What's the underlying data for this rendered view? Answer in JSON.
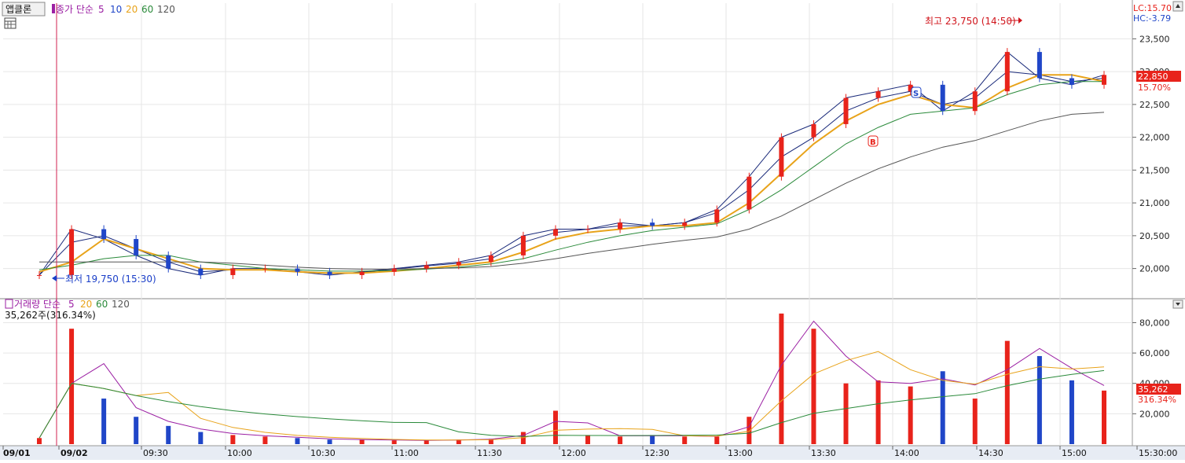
{
  "stock_name": "앱클론",
  "price_legend": {
    "prefix": "종가 단순",
    "periods": [
      "5",
      "10",
      "20",
      "60",
      "120"
    ]
  },
  "volume_legend": {
    "prefix": "거래량 단순",
    "periods": [
      "5",
      "20",
      "60",
      "120"
    ]
  },
  "volume_readout": "35,262주(316.34%)",
  "limit_info": {
    "lc": "LC:15.70",
    "hc": "HC:-3.79"
  },
  "current_price": {
    "value": "22,850",
    "change": "15.70%"
  },
  "current_volume": {
    "value": "35,262",
    "change": "316.34%"
  },
  "annotations": {
    "high": "최고 23,750 (14:50)",
    "low": "최저 19,750 (15:30)",
    "buy_marker": "B",
    "sell_marker": "S"
  },
  "colors": {
    "up": "#e8231b",
    "down": "#2046c8",
    "ma5": "#1a2a7a",
    "ma10": "#1a2a7a",
    "ma20": "#e8a31a",
    "ma60": "#2a8a3a",
    "ma120": "#555555",
    "legend_ma5": "#9b1fa3",
    "legend_ma10": "#2046c8",
    "legend_ma20": "#e8a31a",
    "legend_ma60": "#2a8a3a",
    "legend_ma120": "#555555",
    "grid": "#e6e6e6",
    "axis_bg": "#e7ecf4"
  },
  "chart_data": [
    {
      "type": "candlestick",
      "title": "",
      "x_ticks": [
        "09/01",
        "09/02",
        "09:30",
        "10:00",
        "10:30",
        "11:00",
        "11:30",
        "12:00",
        "12:30",
        "13:00",
        "13:30",
        "14:00",
        "14:30",
        "15:00",
        "15:30:00"
      ],
      "y_ticks": [
        20000,
        20500,
        21000,
        21500,
        22000,
        22500,
        23000,
        23500
      ],
      "ylim": [
        19600,
        23900
      ],
      "grid": true,
      "series": [
        {
          "name": "5",
          "values": [
            19900,
            20600,
            20450,
            20200,
            20000,
            19900,
            20000,
            20000,
            19950,
            19900,
            19950,
            20000,
            20050,
            20100,
            20200,
            20500,
            20600,
            20600,
            20700,
            20650,
            20700,
            20900,
            21400,
            22000,
            22200,
            22600,
            22700,
            22800,
            22400,
            22700,
            23300,
            22900,
            22800,
            22950
          ]
        },
        {
          "name": "10",
          "values": [
            19900,
            20400,
            20500,
            20300,
            20100,
            19950,
            19980,
            19980,
            19960,
            19920,
            19940,
            19990,
            20040,
            20080,
            20150,
            20400,
            20550,
            20600,
            20650,
            20650,
            20700,
            20850,
            21200,
            21700,
            22000,
            22400,
            22600,
            22700,
            22500,
            22600,
            23000,
            22950,
            22850,
            22900
          ]
        },
        {
          "name": "20",
          "values": [
            19950,
            20100,
            20450,
            20300,
            20150,
            20000,
            19980,
            19980,
            19950,
            19930,
            19930,
            19960,
            20000,
            20050,
            20100,
            20250,
            20450,
            20550,
            20600,
            20650,
            20650,
            20700,
            21000,
            21450,
            21900,
            22250,
            22500,
            22650,
            22500,
            22450,
            22750,
            22950,
            22950,
            22850
          ]
        },
        {
          "name": "60",
          "values": [
            19980,
            20050,
            20150,
            20200,
            20200,
            20100,
            20050,
            20000,
            19980,
            19960,
            19960,
            19970,
            19990,
            20020,
            20070,
            20150,
            20280,
            20400,
            20500,
            20580,
            20630,
            20680,
            20900,
            21200,
            21550,
            21900,
            22150,
            22350,
            22400,
            22450,
            22650,
            22800,
            22850,
            22850
          ]
        },
        {
          "name": "120",
          "values": [
            20100,
            20100,
            20100,
            20100,
            20100,
            20100,
            20080,
            20050,
            20020,
            20000,
            19990,
            19990,
            20000,
            20010,
            20030,
            20080,
            20150,
            20230,
            20300,
            20370,
            20430,
            20480,
            20600,
            20800,
            21050,
            21300,
            21520,
            21700,
            21850,
            21950,
            22100,
            22250,
            22350,
            22380
          ]
        }
      ]
    },
    {
      "type": "bar",
      "title": "",
      "y_ticks": [
        20000,
        40000,
        60000,
        80000
      ],
      "ylim": [
        0,
        88000
      ],
      "grid": true,
      "values": [
        4000,
        76000,
        30000,
        18000,
        12000,
        8000,
        6000,
        5000,
        4000,
        3000,
        3000,
        2500,
        2500,
        3000,
        3500,
        8000,
        22000,
        6000,
        5000,
        6000,
        5000,
        5000,
        18000,
        86000,
        76000,
        40000,
        42000,
        38000,
        48000,
        30000,
        68000,
        58000,
        42000,
        35262
      ]
    }
  ]
}
